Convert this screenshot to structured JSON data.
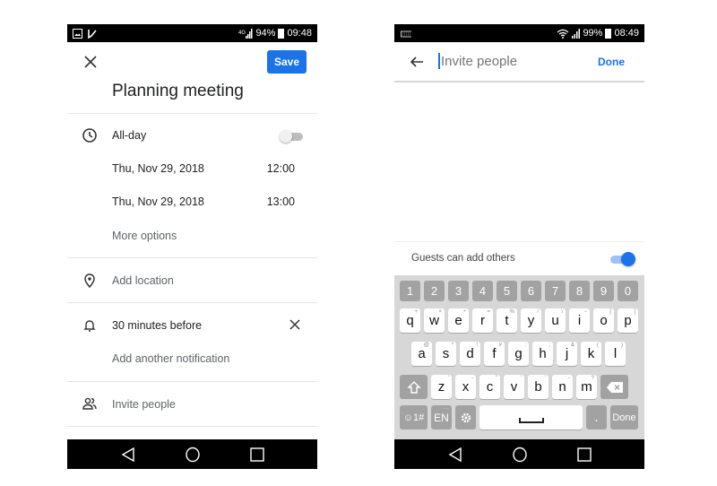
{
  "left_screen": {
    "status_bar": {
      "left_icons": [
        "image-notification-icon",
        "missed-call-icon"
      ],
      "signal_icon": "4g-signal-icon",
      "battery": "94%",
      "time": "09:48"
    },
    "header": {
      "close_icon": "close-icon",
      "save_label": "Save"
    },
    "event_title": "Planning meeting",
    "all_day": {
      "label": "All-day",
      "enabled": false
    },
    "start": {
      "date": "Thu, Nov 29, 2018",
      "time": "12:00"
    },
    "end": {
      "date": "Thu, Nov 29, 2018",
      "time": "13:00"
    },
    "more_options": "More options",
    "location_placeholder": "Add location",
    "notification": {
      "value": "30 minutes before",
      "add_another": "Add another notification"
    },
    "invite_people": "Invite people"
  },
  "right_screen": {
    "status_bar": {
      "left_icons": [
        "keyboard-icon"
      ],
      "wifi_icon": "wifi-icon",
      "signal_icon": "signal-icon",
      "battery": "99%",
      "time": "08:49"
    },
    "header": {
      "back_icon": "back-arrow-icon",
      "search_placeholder": "Invite people",
      "done_label": "Done"
    },
    "guests_option": {
      "label": "Guests can add others",
      "enabled": true
    },
    "keyboard": {
      "number_row": [
        "1",
        "2",
        "3",
        "4",
        "5",
        "6",
        "7",
        "8",
        "9",
        "0"
      ],
      "row1": [
        {
          "k": "q",
          "h": "+"
        },
        {
          "k": "w",
          "h": "×"
        },
        {
          "k": "e",
          "h": "÷"
        },
        {
          "k": "r",
          "h": "="
        },
        {
          "k": "t",
          "h": "%"
        },
        {
          "k": "y",
          "h": "/"
        },
        {
          "k": "u",
          "h": "\\"
        },
        {
          "k": "i",
          "h": "−"
        },
        {
          "k": "o",
          "h": "["
        },
        {
          "k": "p",
          "h": "]"
        }
      ],
      "row2": [
        {
          "k": "a",
          "h": "@"
        },
        {
          "k": "s",
          "h": "*"
        },
        {
          "k": "d",
          "h": "!"
        },
        {
          "k": "f",
          "h": "#"
        },
        {
          "k": "g",
          "h": ":"
        },
        {
          "k": "h",
          "h": ";"
        },
        {
          "k": "j",
          "h": "&"
        },
        {
          "k": "k",
          "h": "("
        },
        {
          "k": "l",
          "h": ")"
        }
      ],
      "row3": [
        {
          "k": "z",
          "h": "'"
        },
        {
          "k": "x",
          "h": "-"
        },
        {
          "k": "c",
          "h": "\""
        },
        {
          "k": "v",
          "h": "'"
        },
        {
          "k": "b",
          "h": "'"
        },
        {
          "k": "n",
          "h": "-"
        },
        {
          "k": "m",
          "h": "?"
        }
      ],
      "shift_icon": "shift-icon",
      "backspace_icon": "backspace-icon",
      "symbols_label": "☺1#",
      "language_label": "EN",
      "settings_icon": "gear-icon",
      "period_label": ".",
      "done_label": "Done"
    }
  },
  "nav_bar": {
    "back_icon": "nav-back-icon",
    "home_icon": "nav-home-icon",
    "recents_icon": "nav-recents-icon"
  }
}
